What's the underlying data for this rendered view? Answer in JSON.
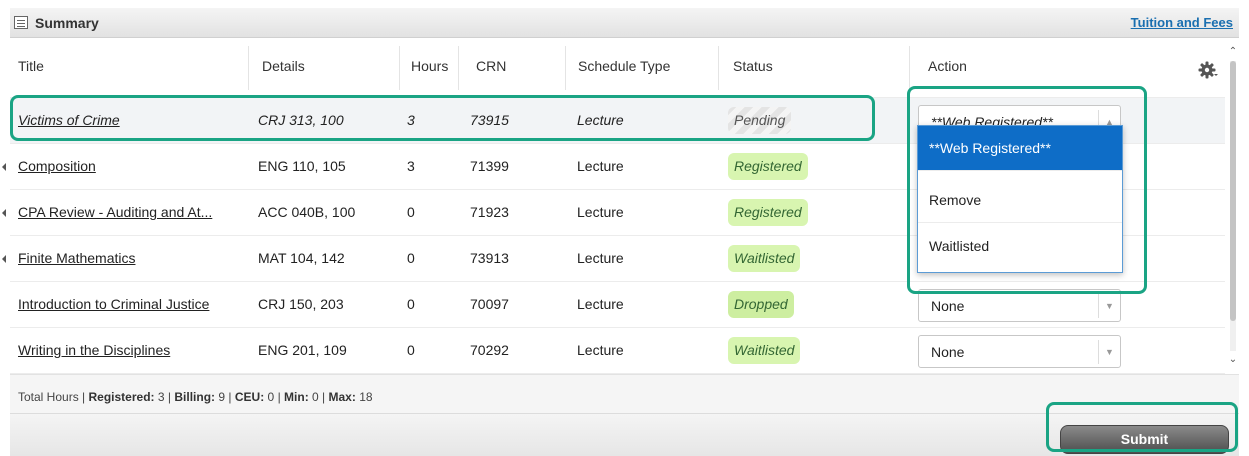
{
  "header": {
    "title": "Summary",
    "link": "Tuition and Fees"
  },
  "columns": [
    "Title",
    "Details",
    "Hours",
    "CRN",
    "Schedule Type",
    "Status",
    "Action"
  ],
  "rows": [
    {
      "title": "Victims of Crime",
      "details": "CRJ 313, 100",
      "hours": "3",
      "crn": "73915",
      "type": "Lecture",
      "status": "Pending",
      "action": "**Web Registered**"
    },
    {
      "title": "Composition",
      "details": "ENG 110, 105",
      "hours": "3",
      "crn": "71399",
      "type": "Lecture",
      "status": "Registered",
      "action": ""
    },
    {
      "title": "CPA Review - Auditing and At...",
      "details": "ACC 040B, 100",
      "hours": "0",
      "crn": "71923",
      "type": "Lecture",
      "status": "Registered",
      "action": ""
    },
    {
      "title": "Finite Mathematics",
      "details": "MAT 104, 142",
      "hours": "0",
      "crn": "73913",
      "type": "Lecture",
      "status": "Waitlisted",
      "action": ""
    },
    {
      "title": "Introduction to Criminal Justice",
      "details": "CRJ 150, 203",
      "hours": "0",
      "crn": "70097",
      "type": "Lecture",
      "status": "Dropped",
      "action": "None"
    },
    {
      "title": "Writing in the Disciplines",
      "details": "ENG 201, 109",
      "hours": "0",
      "crn": "70292",
      "type": "Lecture",
      "status": "Waitlisted",
      "action": "None"
    }
  ],
  "dropdown": {
    "options": [
      "**Web Registered**",
      "Remove",
      "Waitlisted"
    ],
    "selected": "**Web Registered**"
  },
  "footer": {
    "prefix": "Total Hours |",
    "registered_label": "Registered:",
    "registered": "3",
    "billing_label": "Billing:",
    "billing": "9",
    "ceu_label": "CEU:",
    "ceu": "0",
    "min_label": "Min:",
    "min": "0",
    "max_label": "Max:",
    "max": "18"
  },
  "submit_label": "Submit",
  "colors": {
    "accent_link": "#1a6fb0",
    "highlight": "#1aa484",
    "status_green": "#d8f5b0",
    "selected_option": "#0e6dc7"
  },
  "icons": [
    "summary-icon",
    "gear-icon",
    "scroll-up-icon",
    "scroll-down-icon",
    "dropdown-arrow-icon"
  ]
}
